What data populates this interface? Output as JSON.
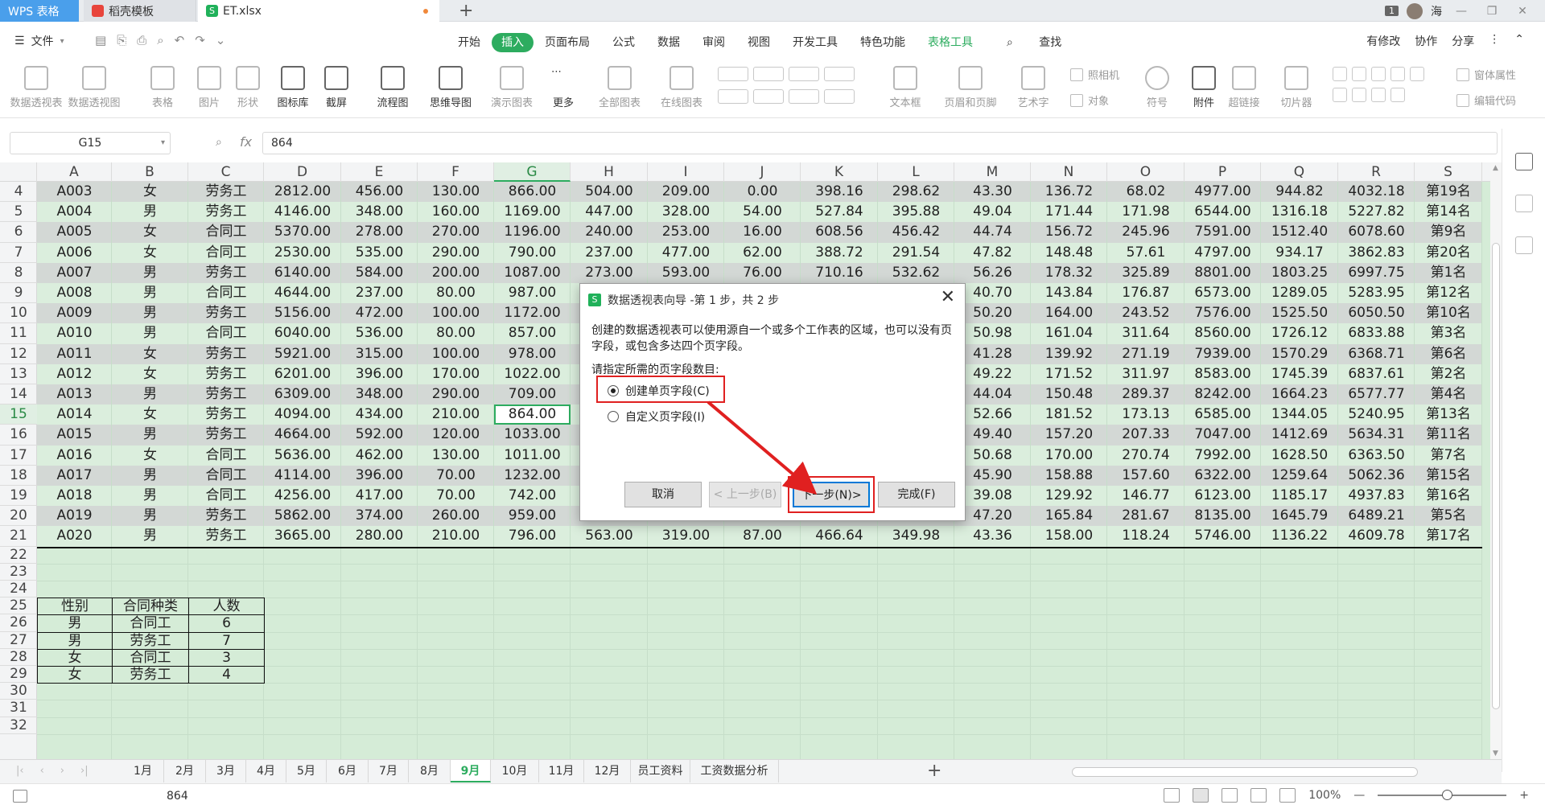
{
  "titlebar": {
    "tabs": [
      "WPS 表格",
      "稻壳模板",
      "ET.xlsx"
    ],
    "new_tab": "+",
    "notif_count": "1",
    "user": "海"
  },
  "menubar": {
    "file": "文件",
    "tabs": [
      "开始",
      "插入",
      "页面布局",
      "公式",
      "数据",
      "审阅",
      "视图",
      "开发工具",
      "特色功能",
      "表格工具"
    ],
    "search": "查找",
    "right": [
      "有修改",
      "协作",
      "分享"
    ]
  },
  "ribbon": {
    "items": [
      "数据透视表",
      "数据透视图",
      "表格",
      "图片",
      "形状",
      "图标库",
      "截屏",
      "流程图",
      "思维导图",
      "演示图表",
      "更多",
      "全部图表",
      "在线图表",
      "文本框",
      "页眉和页脚",
      "艺术字",
      "照相机",
      "对象",
      "符号",
      "附件",
      "超链接",
      "切片器",
      "窗体属性",
      "编辑代码"
    ]
  },
  "formula": {
    "cell_ref": "G15",
    "fx": "fx",
    "value": "864"
  },
  "sheet": {
    "columns": [
      "A",
      "B",
      "C",
      "D",
      "E",
      "F",
      "G",
      "H",
      "I",
      "J",
      "K",
      "L",
      "M",
      "N",
      "O",
      "P",
      "Q",
      "R",
      "S"
    ],
    "rows": [
      [
        "4",
        "A003",
        "女",
        "劳务工",
        "2812.00",
        "456.00",
        "130.00",
        "866.00",
        "504.00",
        "209.00",
        "0.00",
        "398.16",
        "298.62",
        "43.30",
        "136.72",
        "68.02",
        "4977.00",
        "944.82",
        "4032.18",
        "第19名"
      ],
      [
        "5",
        "A004",
        "男",
        "劳务工",
        "4146.00",
        "348.00",
        "160.00",
        "1169.00",
        "447.00",
        "328.00",
        "54.00",
        "527.84",
        "395.88",
        "49.04",
        "171.44",
        "171.98",
        "6544.00",
        "1316.18",
        "5227.82",
        "第14名"
      ],
      [
        "6",
        "A005",
        "女",
        "合同工",
        "5370.00",
        "278.00",
        "270.00",
        "1196.00",
        "240.00",
        "253.00",
        "16.00",
        "608.56",
        "456.42",
        "44.74",
        "156.72",
        "245.96",
        "7591.00",
        "1512.40",
        "6078.60",
        "第9名"
      ],
      [
        "7",
        "A006",
        "女",
        "合同工",
        "2530.00",
        "535.00",
        "290.00",
        "790.00",
        "237.00",
        "477.00",
        "62.00",
        "388.72",
        "291.54",
        "47.82",
        "148.48",
        "57.61",
        "4797.00",
        "934.17",
        "3862.83",
        "第20名"
      ],
      [
        "8",
        "A007",
        "男",
        "劳务工",
        "6140.00",
        "584.00",
        "200.00",
        "1087.00",
        "273.00",
        "593.00",
        "76.00",
        "710.16",
        "532.62",
        "56.26",
        "178.32",
        "325.89",
        "8801.00",
        "1803.25",
        "6997.75",
        "第1名"
      ],
      [
        "9",
        "A008",
        "男",
        "合同工",
        "4644.00",
        "237.00",
        "80.00",
        "987.00",
        "",
        "",
        "",
        "",
        "",
        "40.70",
        "143.84",
        "176.87",
        "6573.00",
        "1289.05",
        "5283.95",
        "第12名"
      ],
      [
        "10",
        "A009",
        "男",
        "劳务工",
        "5156.00",
        "472.00",
        "100.00",
        "1172.00",
        "",
        "",
        "",
        "",
        "",
        "50.20",
        "164.00",
        "243.52",
        "7576.00",
        "1525.50",
        "6050.50",
        "第10名"
      ],
      [
        "11",
        "A010",
        "男",
        "合同工",
        "6040.00",
        "536.00",
        "80.00",
        "857.00",
        "",
        "",
        "",
        "",
        "",
        "50.98",
        "161.04",
        "311.64",
        "8560.00",
        "1726.12",
        "6833.88",
        "第3名"
      ],
      [
        "12",
        "A011",
        "女",
        "劳务工",
        "5921.00",
        "315.00",
        "100.00",
        "978.00",
        "",
        "",
        "",
        "",
        "",
        "41.28",
        "139.92",
        "271.19",
        "7939.00",
        "1570.29",
        "6368.71",
        "第6名"
      ],
      [
        "13",
        "A012",
        "女",
        "劳务工",
        "6201.00",
        "396.00",
        "170.00",
        "1022.00",
        "",
        "",
        "",
        "",
        "",
        "49.22",
        "171.52",
        "311.97",
        "8583.00",
        "1745.39",
        "6837.61",
        "第2名"
      ],
      [
        "14",
        "A013",
        "男",
        "劳务工",
        "6309.00",
        "348.00",
        "290.00",
        "709.00",
        "",
        "",
        "",
        "",
        "",
        "44.04",
        "150.48",
        "289.37",
        "8242.00",
        "1664.23",
        "6577.77",
        "第4名"
      ],
      [
        "15",
        "A014",
        "女",
        "劳务工",
        "4094.00",
        "434.00",
        "210.00",
        "864.00",
        "",
        "",
        "",
        "",
        "",
        "52.66",
        "181.52",
        "173.13",
        "6585.00",
        "1344.05",
        "5240.95",
        "第13名"
      ],
      [
        "16",
        "A015",
        "男",
        "劳务工",
        "4664.00",
        "592.00",
        "120.00",
        "1033.00",
        "",
        "",
        "",
        "",
        "",
        "49.40",
        "157.20",
        "207.33",
        "7047.00",
        "1412.69",
        "5634.31",
        "第11名"
      ],
      [
        "17",
        "A016",
        "女",
        "合同工",
        "5636.00",
        "462.00",
        "130.00",
        "1011.00",
        "",
        "",
        "",
        "",
        "",
        "50.68",
        "170.00",
        "270.74",
        "7992.00",
        "1628.50",
        "6363.50",
        "第7名"
      ],
      [
        "18",
        "A017",
        "男",
        "合同工",
        "4114.00",
        "396.00",
        "70.00",
        "1232.00",
        "",
        "",
        "",
        "",
        "",
        "45.90",
        "158.88",
        "157.60",
        "6322.00",
        "1259.64",
        "5062.36",
        "第15名"
      ],
      [
        "19",
        "A018",
        "男",
        "合同工",
        "4256.00",
        "417.00",
        "70.00",
        "742.00",
        "",
        "",
        "",
        "",
        "",
        "39.08",
        "129.92",
        "146.77",
        "6123.00",
        "1185.17",
        "4937.83",
        "第16名"
      ],
      [
        "20",
        "A019",
        "男",
        "劳务工",
        "5862.00",
        "374.00",
        "260.00",
        "959.00",
        "",
        "",
        "",
        "",
        "",
        "47.20",
        "165.84",
        "281.67",
        "8135.00",
        "1645.79",
        "6489.21",
        "第5名"
      ],
      [
        "21",
        "A020",
        "男",
        "劳务工",
        "3665.00",
        "280.00",
        "210.00",
        "796.00",
        "563.00",
        "319.00",
        "87.00",
        "466.64",
        "349.98",
        "43.36",
        "158.00",
        "118.24",
        "5746.00",
        "1136.22",
        "4609.78",
        "第17名"
      ]
    ],
    "empty_rows": [
      "22",
      "23",
      "24",
      "25",
      "26",
      "27",
      "28",
      "29",
      "30",
      "31",
      "32"
    ],
    "summary": {
      "header": [
        "性别",
        "合同种类",
        "人数"
      ],
      "rows": [
        [
          "男",
          "合同工",
          "6"
        ],
        [
          "男",
          "劳务工",
          "7"
        ],
        [
          "女",
          "合同工",
          "3"
        ],
        [
          "女",
          "劳务工",
          "4"
        ]
      ]
    }
  },
  "sheet_tabs": [
    "1月",
    "2月",
    "3月",
    "4月",
    "5月",
    "6月",
    "7月",
    "8月",
    "9月",
    "10月",
    "11月",
    "12月",
    "员工资料",
    "工资数据分析"
  ],
  "active_sheet": "9月",
  "status": {
    "value": "864",
    "zoom": "100%"
  },
  "dialog": {
    "title": "数据透视表向导 -第 1 步，共 2 步",
    "description": "创建的数据透视表可以使用源自一个或多个工作表的区域，也可以没有页字段，或包含多达四个页字段。",
    "prompt": "请指定所需的页字段数目:",
    "option1": "创建单页字段(C)",
    "option2": "自定义页字段(I)",
    "buttons": {
      "cancel": "取消",
      "prev": "< 上一步(B)",
      "next": "下一步(N)>",
      "finish": "完成(F)"
    }
  },
  "colors": {
    "accent": "#2dac5f",
    "sheet_bg": "#d5ecd7",
    "highlight": "#e02020"
  }
}
